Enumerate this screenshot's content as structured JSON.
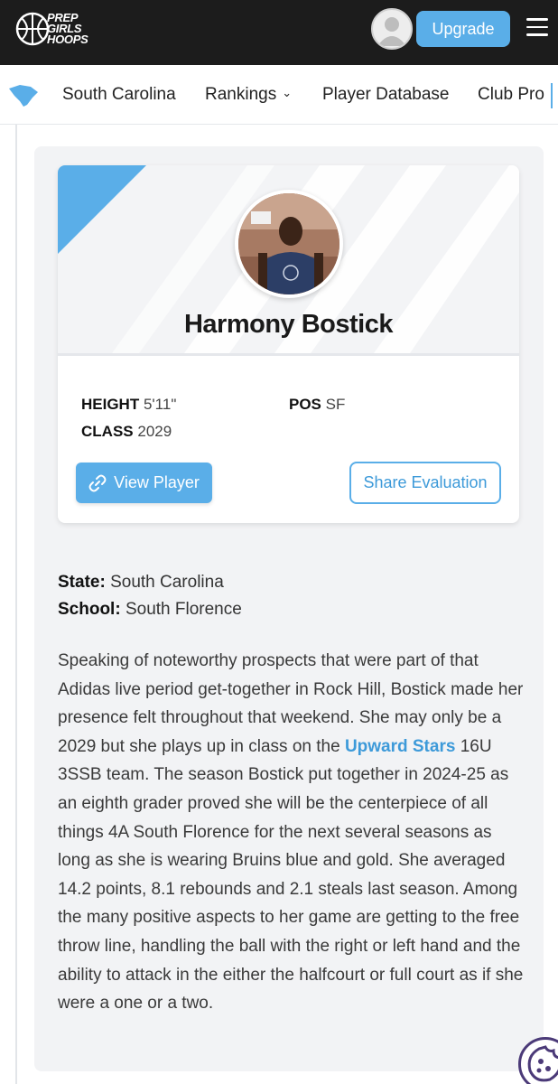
{
  "header": {
    "logo_lines": [
      "PREP",
      "GIRLS",
      "HOOPS"
    ],
    "upgrade_label": "Upgrade"
  },
  "nav": {
    "items": [
      "South Carolina",
      "Rankings",
      "Player Database",
      "Club Pro"
    ]
  },
  "player": {
    "name": "Harmony Bostick",
    "height_label": "HEIGHT",
    "height_value": "5'11\"",
    "class_label": "CLASS",
    "class_value": "2029",
    "pos_label": "POS",
    "pos_value": "SF",
    "view_label": "View Player",
    "share_label": "Share Evaluation"
  },
  "meta": {
    "state_label": "State:",
    "state_value": "South Carolina",
    "school_label": "School:",
    "school_value": "South Florence"
  },
  "article": {
    "before_link": "Speaking of noteworthy prospects that were part of that Adidas live period get-together in Rock Hill, Bostick made her presence felt throughout that weekend. She may only be a 2029 but she plays up in class on the ",
    "link_text": "Upward Stars",
    "after_link": " 16U 3SSB team. The season Bostick put together in 2024-25 as an eighth grader proved she will be the centerpiece of all things 4A South Florence for the next several seasons as long as she is wearing Bruins blue and gold. She averaged 14.2 points, 8.1 rebounds and 2.1 steals last season. Among the many positive aspects to her game are getting to the free throw line, handling the ball with the right or left hand and the ability to attack in the either the halfcourt or full court as if she were a one or a two."
  },
  "colors": {
    "accent": "#5aaee8",
    "header_bg": "#1c1c1c",
    "link": "#3d9ad9"
  },
  "icons": [
    "basketball-logo-icon",
    "user-avatar-icon",
    "hamburger-menu-icon",
    "south-carolina-map-icon",
    "chevron-down-icon",
    "link-icon",
    "cookie-icon"
  ]
}
